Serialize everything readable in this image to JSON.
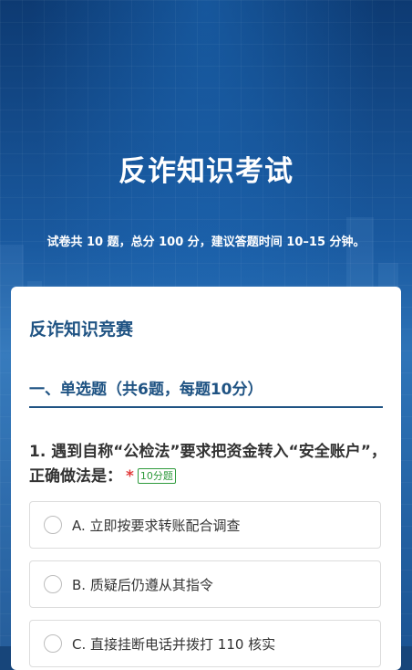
{
  "header": {
    "title": "反诈知识考试",
    "subtitle": "试卷共 10 题，总分 100 分，建议答题时间 10–15 分钟。"
  },
  "exam": {
    "name": "反诈知识竞赛",
    "section_title": "一、单选题（共6题，每题10分）"
  },
  "question1": {
    "text": "1. 遇到自称“公检法”要求把资金转入“安全账户”，正确做法是：",
    "required_mark": "*",
    "score_badge": "10分题",
    "options": [
      {
        "label": "A. 立即按要求转账配合调查"
      },
      {
        "label": "B. 质疑后仍遵从其指令"
      },
      {
        "label": "C. 直接挂断电话并拨打 110 核实"
      }
    ]
  },
  "colors": {
    "primary": "#1f5383",
    "required": "#e23b3b",
    "badge": "#2e9a3c"
  }
}
